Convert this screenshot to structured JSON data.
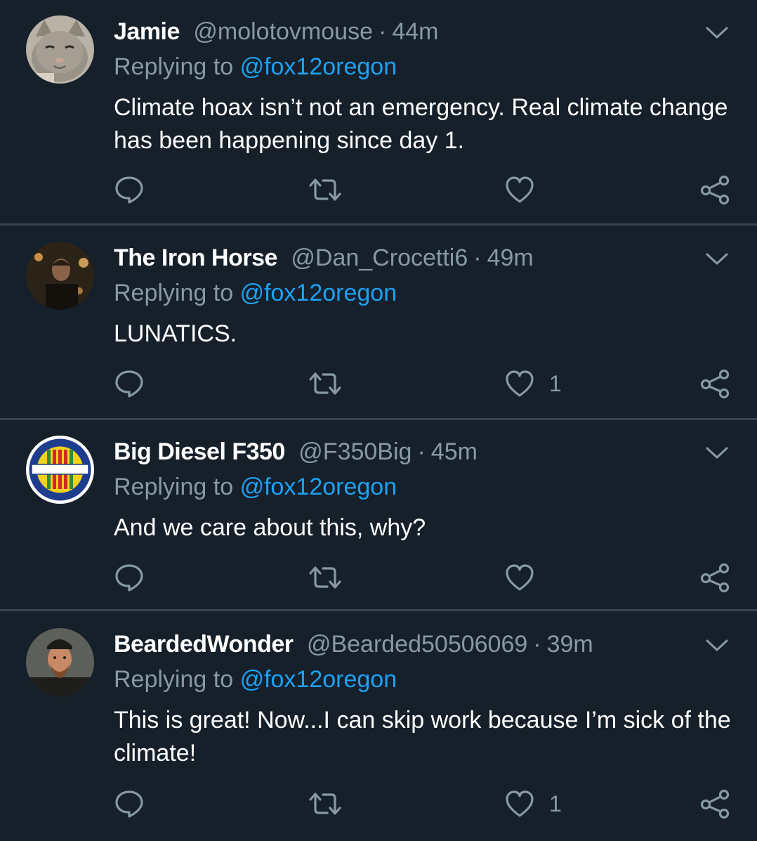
{
  "reply_prefix": "Replying to",
  "colors": {
    "background": "#15202b",
    "divider": "#38444d",
    "secondary_text": "#8899a6",
    "mention": "#1da1f2",
    "primary_text": "#ffffff"
  },
  "icons": {
    "reply": "reply-icon",
    "retweet": "retweet-icon",
    "like": "heart-icon",
    "share": "share-icon",
    "menu": "chevron-down-icon"
  },
  "tweets": [
    {
      "name": "Jamie",
      "handle": "@molotovmouse",
      "separator": "·",
      "time": "44m",
      "reply_to": "@fox12oregon",
      "text": "Climate hoax isn’t not an emergency. Real climate change has been happening since day 1.",
      "likes": ""
    },
    {
      "name": "The Iron Horse",
      "handle": "@Dan_Crocetti6",
      "separator": "·",
      "time": "49m",
      "reply_to": "@fox12oregon",
      "text": "LUNATICS.",
      "likes": "1"
    },
    {
      "name": "Big Diesel F350",
      "handle": "@F350Big",
      "separator": "·",
      "time": "45m",
      "reply_to": "@fox12oregon",
      "text": "And we care about this, why?",
      "likes": ""
    },
    {
      "name": "BeardedWonder",
      "handle": "@Bearded50506069",
      "separator": "·",
      "time": "39m",
      "reply_to": "@fox12oregon",
      "text": "This is great!  Now...I can skip work because I’m sick of the climate!",
      "likes": "1"
    }
  ]
}
